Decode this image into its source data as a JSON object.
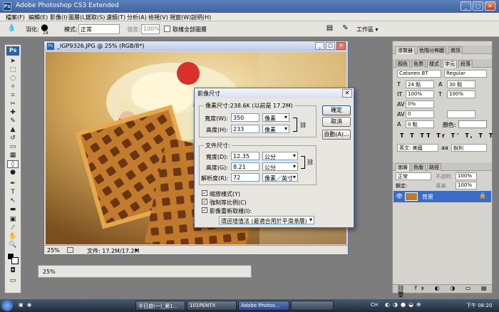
{
  "app": {
    "title": "Adobe Photoshop CS3 Extended"
  },
  "menu": [
    "檔案(F)",
    "編輯(E)",
    "影像(I)",
    "圖層(L)",
    "選取(S)",
    "濾鏡(T)",
    "分析(A)",
    "檢視(V)",
    "視窗(W)",
    "說明(H)"
  ],
  "options": {
    "feather_label": "羽化:",
    "feather_value": "19",
    "mode_label": "模式:",
    "mode_value": "正常",
    "strength_label": "強度:",
    "strength_value": "100%",
    "sample_all_label": "取樣全部圖層",
    "workspace_label": "工作區 ▾"
  },
  "document": {
    "title": "_IGP9326.JPG @ 25% (RGB/8*)",
    "zoom": "25%",
    "file_info": "文件: 17.2M/17.2M",
    "zoom2": "25%"
  },
  "dialog": {
    "title": "影像尺寸",
    "pixel_dim_label": "像素尺寸:238.6K (以前是 17.2M)",
    "width_label": "寬度(W):",
    "width_value": "350",
    "width_unit": "像素",
    "height_label": "高度(H):",
    "height_value": "233",
    "height_unit": "像素",
    "doc_size_label": "文件尺寸:",
    "doc_width_label": "寬度(D):",
    "doc_width_value": "12.35",
    "doc_width_unit": "公分",
    "doc_height_label": "高度(G):",
    "doc_height_value": "8.21",
    "doc_height_unit": "公分",
    "resolution_label": "解析度(R):",
    "resolution_value": "72",
    "resolution_unit": "像素／英寸",
    "scale_styles_label": "縮放樣式(Y)",
    "constrain_label": "強制等比例(C)",
    "resample_label": "影像重新取樣(I):",
    "resample_method": "環迴增值法 (最適合用於平滑漸層)",
    "ok": "確定",
    "cancel": "取消",
    "auto": "自動(A)..."
  },
  "panels": {
    "top_tabs": [
      "導覽器",
      "色階分佈圖",
      "資訊"
    ],
    "mid_tabs": [
      "顏色",
      "色票",
      "樣式",
      "字元",
      "段落"
    ],
    "font_family": "Cataneo BT",
    "font_style": "Regular",
    "font_size": "24 點",
    "leading": "30 點",
    "vscale": "100%",
    "hscale": "100%",
    "tracking": "0",
    "kerning": "0%",
    "baseline": "0 點",
    "color_label": "顏色:",
    "language": "英文: 美國",
    "aa_icon": "aa",
    "aa_mode": "銳利",
    "layer_tabs": [
      "圖層",
      "色版",
      "路徑"
    ],
    "blend_mode": "正常",
    "opacity_label": "不透明:",
    "opacity": "100%",
    "lock_label": "鎖定:",
    "fill_label": "填滿:",
    "fill": "100%",
    "layer_name": "背景"
  },
  "taskbar": {
    "buttons": [
      "半日遊(一)_第1...",
      "101PENTX",
      "Adobe Photos...",
      ""
    ],
    "lang": "CH",
    "time": "下午 08:20"
  }
}
